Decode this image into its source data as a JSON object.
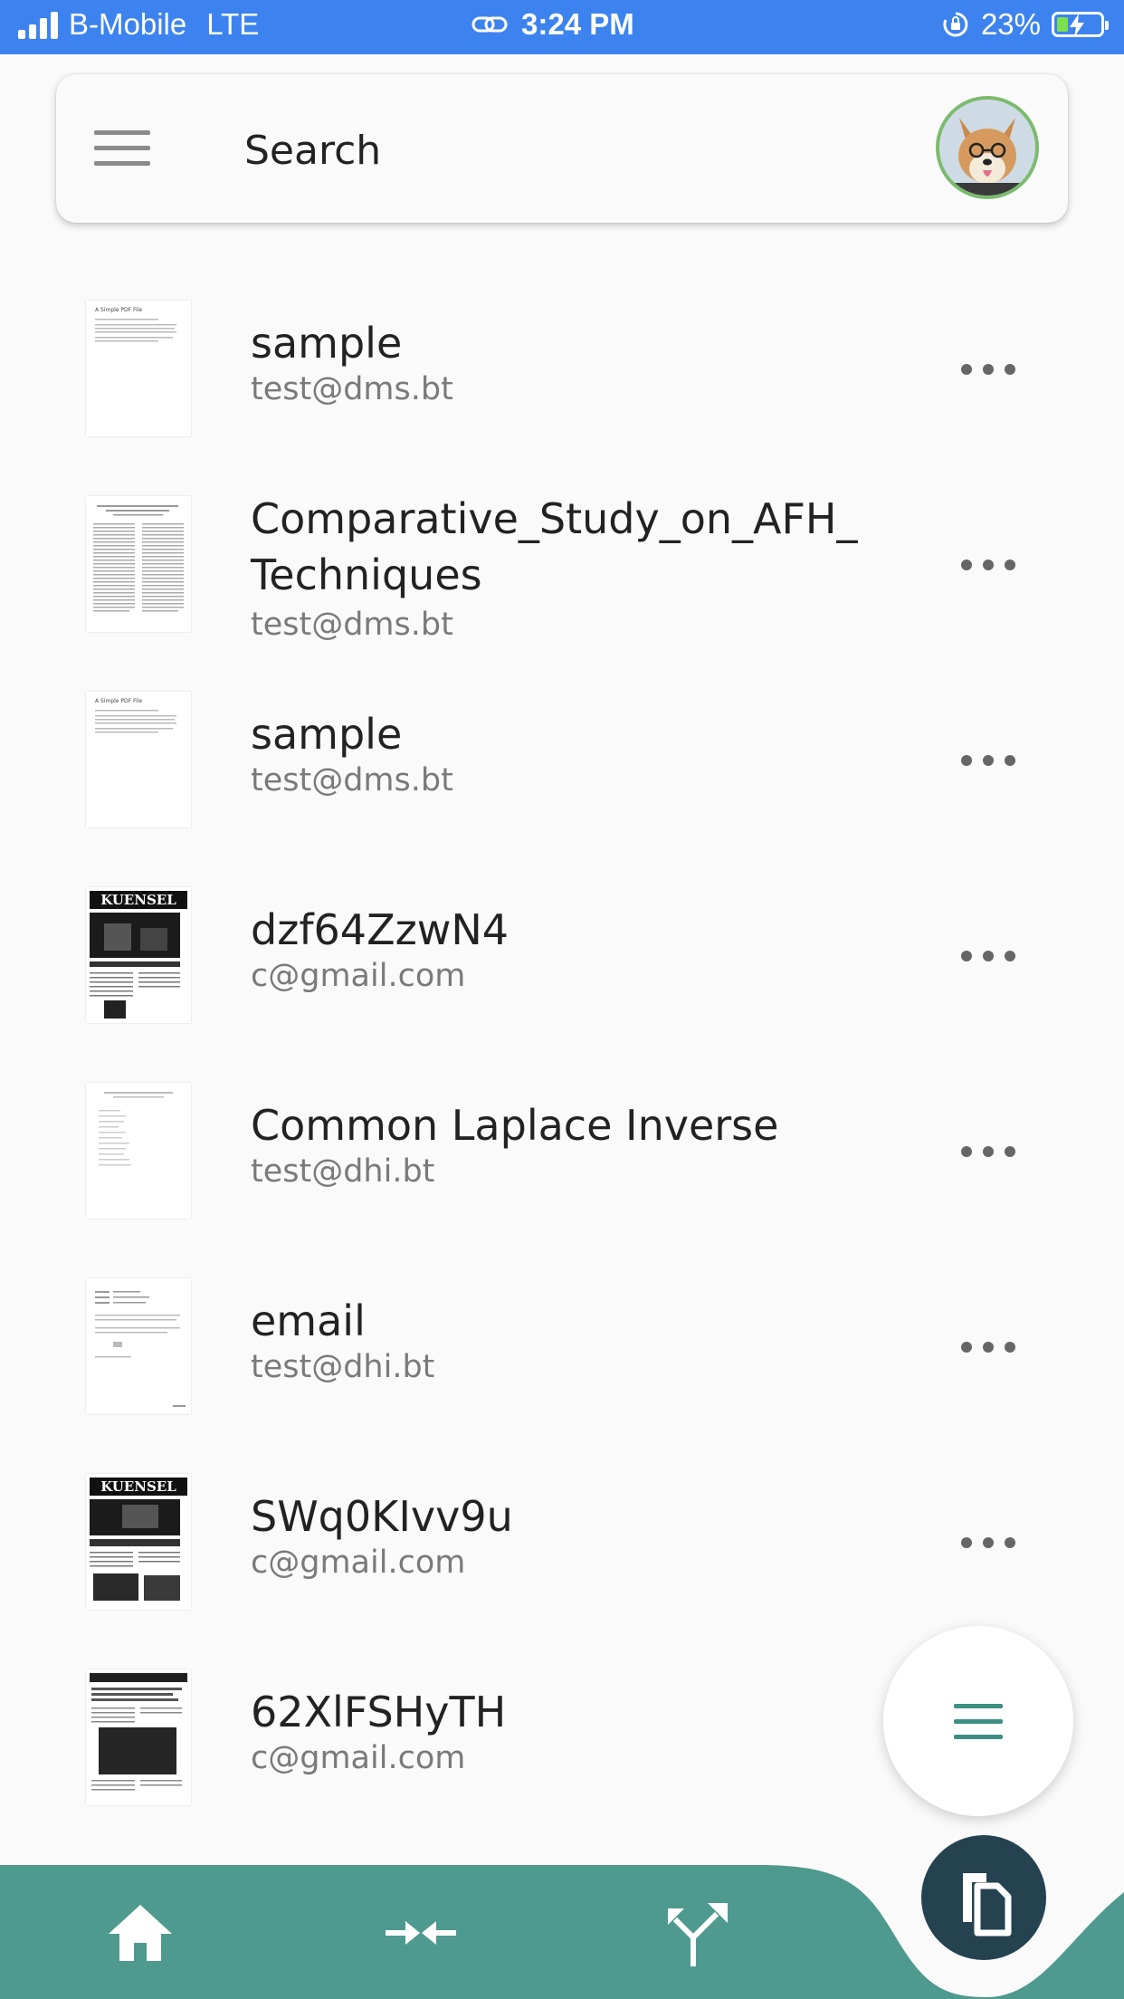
{
  "status_bar": {
    "carrier": "B-Mobile",
    "network": "LTE",
    "time": "3:24 PM",
    "battery": "23%"
  },
  "search": {
    "placeholder": "Search"
  },
  "documents": [
    {
      "title": "sample",
      "owner": "test@dms.bt"
    },
    {
      "title": "Comparative_Study_on_AFH_",
      "title_line2": "Techniques",
      "owner": "test@dms.bt"
    },
    {
      "title": "sample",
      "owner": "test@dms.bt"
    },
    {
      "title": "dzf64ZzwN4",
      "owner": "c@gmail.com"
    },
    {
      "title": "Common Laplace Inverse",
      "owner": "test@dhi.bt"
    },
    {
      "title": "email",
      "owner": "test@dhi.bt"
    },
    {
      "title": "SWq0KIvv9u",
      "owner": "c@gmail.com"
    },
    {
      "title": "62XlFSHyTH",
      "owner": "c@gmail.com"
    }
  ],
  "thumbs": {
    "pdf_title": "A Simple PDF File",
    "kuensel": "KUENSEL"
  },
  "colors": {
    "status_bar": "#3d83ef",
    "nav": "#4f9a8e",
    "docs_button": "#24424f",
    "avatar_ring": "#7cbb6e",
    "fab_icon": "#3f8e83"
  },
  "icons": {
    "menu": "hamburger-icon",
    "home": "home-icon",
    "merge": "merge-icon",
    "split": "split-icon",
    "documents": "documents-icon",
    "more": "more-horizontal-icon"
  }
}
